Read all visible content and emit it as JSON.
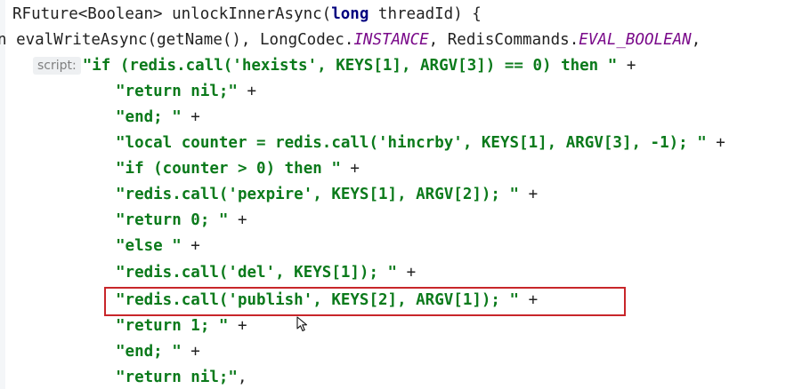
{
  "code": {
    "method_signature": {
      "part1": "RFuture<Boolean> unlockInnerAsync(",
      "keyword": "long",
      "part2": " threadId) {"
    },
    "call_line": {
      "prefix": "n evalWriteAsync(getName(), LongCodec.",
      "const1": "INSTANCE",
      "middle": ", RedisCommands.",
      "const2": "EVAL_BOOLEAN",
      "suffix": ","
    },
    "param_hint": "script:",
    "script_lines": [
      "\"if (redis.call('hexists', KEYS[1], ARGV[3]) == 0) then \"",
      "\"return nil;\"",
      "\"end; \"",
      "\"local counter = redis.call('hincrby', KEYS[1], ARGV[3], -1); \"",
      "\"if (counter > 0) then \"",
      "\"redis.call('pexpire', KEYS[1], ARGV[2]); \"",
      "\"return 0; \"",
      "\"else \"",
      "\"redis.call('del', KEYS[1]); \"",
      "\"redis.call('publish', KEYS[2], ARGV[1]); \"",
      "\"return 1; \"",
      "\"end; \"",
      "\"return nil;\""
    ],
    "plus_suffix": " +",
    "last_suffix": ","
  },
  "colors": {
    "string": "#0b7a1b",
    "keyword": "#00007f",
    "constant": "#7a0a8a",
    "highlight_border": "#c8262a"
  }
}
